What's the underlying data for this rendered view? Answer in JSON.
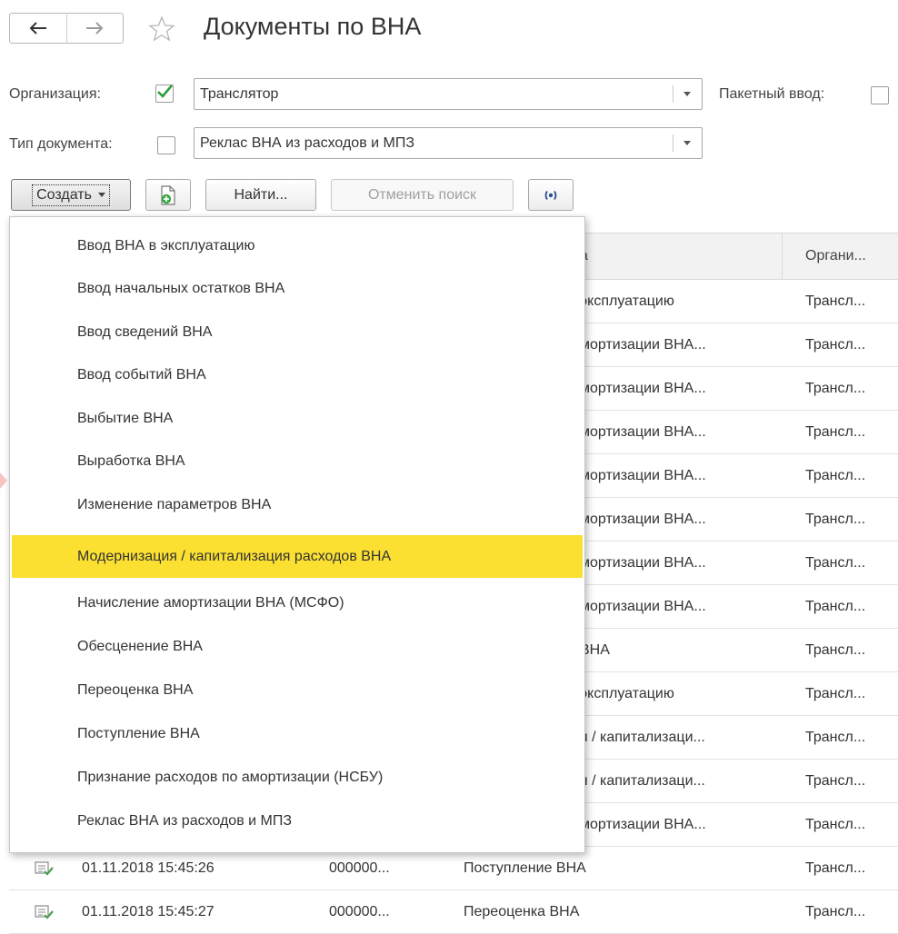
{
  "header": {
    "title": "Документы по ВНА",
    "back_icon": "arrow-left-icon",
    "forward_icon": "arrow-right-icon",
    "favorite_icon": "star-icon"
  },
  "filters": {
    "org_label": "Организация:",
    "org_checked": true,
    "org_value": "Транслятор",
    "batch_label": "Пакетный ввод:",
    "batch_checked": false,
    "doctype_label": "Тип документа:",
    "doctype_checked": false,
    "doctype_value": "Реклас ВНА из расходов и МПЗ"
  },
  "toolbar": {
    "create_label": "Создать",
    "find_label": "Найти...",
    "cancel_search_label": "Отменить поиск",
    "add_icon": "document-add-icon",
    "connection_icon": "broadcast-icon"
  },
  "table": {
    "columns": [
      "а",
      "Органи..."
    ],
    "rows": [
      {
        "type": "эксплуатацию",
        "org": "Трансл..."
      },
      {
        "type": "мортизации ВНА...",
        "org": "Трансл..."
      },
      {
        "type": "мортизации ВНА...",
        "org": "Трансл..."
      },
      {
        "type": "мортизации ВНА...",
        "org": "Трансл..."
      },
      {
        "type": "мортизации ВНА...",
        "org": "Трансл..."
      },
      {
        "type": "мортизации ВНА...",
        "org": "Трансл..."
      },
      {
        "type": "мортизации ВНА...",
        "org": "Трансл..."
      },
      {
        "type": "мортизации ВНА...",
        "org": "Трансл..."
      },
      {
        "type": "ВНА",
        "org": "Трансл..."
      },
      {
        "type": "эксплуатацию",
        "org": "Трансл..."
      },
      {
        "type": "я / капитализаци...",
        "org": "Трансл..."
      },
      {
        "type": "я / капитализаци...",
        "org": "Трансл..."
      },
      {
        "type": "мортизации ВНА...",
        "org": "Трансл..."
      }
    ],
    "visible_rows": [
      {
        "date": "01.11.2018 15:45:26",
        "number": "000000...",
        "type": "Поступление ВНА",
        "org": "Трансл..."
      },
      {
        "date": "01.11.2018 15:45:27",
        "number": "000000...",
        "type": "Переоценка ВНА",
        "org": "Трансл..."
      }
    ]
  },
  "create_menu": {
    "items": [
      "Ввод ВНА в эксплуатацию",
      "Ввод начальных остатков ВНА",
      "Ввод сведений ВНА",
      "Ввод событий ВНА",
      "Выбытие ВНА",
      "Выработка ВНА",
      "Изменение параметров ВНА",
      "Модернизация / капитализация расходов ВНА",
      "Начисление амортизации ВНА (МСФО)",
      "Обесценение ВНА",
      "Переоценка ВНА",
      "Поступление ВНА",
      "Признание расходов по амортизации (НСБУ)",
      "Реклас ВНА из расходов и МПЗ"
    ],
    "highlighted_index": 7
  },
  "colors": {
    "highlight": "#fbe032",
    "check": "#2e9e3a",
    "row_icon": "#4a9e4f"
  }
}
